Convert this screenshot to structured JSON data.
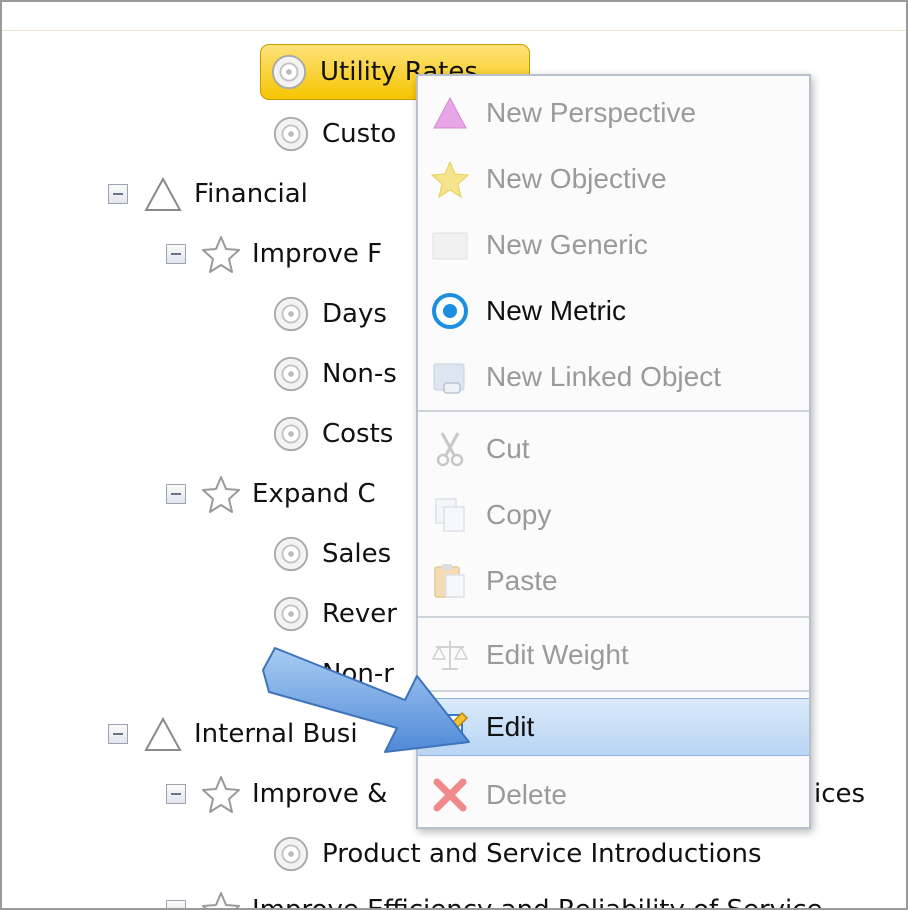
{
  "tree": {
    "rows": [
      {
        "label": "Utility Rates",
        "icon": "metric-icon",
        "selected": true
      },
      {
        "label": "Custo",
        "icon": "metric-icon"
      },
      {
        "label": "Financial",
        "icon": "perspective-icon",
        "expanded": true
      },
      {
        "label": "Improve F",
        "icon": "objective-star-icon",
        "expanded": true
      },
      {
        "label": "Days",
        "icon": "metric-icon"
      },
      {
        "label": "Non-s",
        "icon": "metric-icon"
      },
      {
        "label": "Costs",
        "icon": "metric-icon"
      },
      {
        "label": "Expand C",
        "icon": "objective-star-icon",
        "expanded": true
      },
      {
        "label": "Sales",
        "icon": "metric-icon"
      },
      {
        "label": "Rever",
        "icon": "metric-icon"
      },
      {
        "label": "Non-r",
        "icon": "metric-icon"
      },
      {
        "label": "Internal Busi",
        "icon": "perspective-icon",
        "expanded": true
      },
      {
        "label": "Improve &",
        "icon": "objective-star-icon",
        "expanded": true
      },
      {
        "label": "ices",
        "icon": "none"
      },
      {
        "label": "Product and Service Introductions",
        "icon": "metric-icon"
      },
      {
        "label": "Improve Efficiency and Reliability of Service",
        "icon": "objective-star-icon",
        "expanded": true
      }
    ]
  },
  "context_menu": {
    "items": [
      {
        "label": "New Perspective",
        "icon": "perspective-pink-icon",
        "enabled": false
      },
      {
        "label": "New Objective",
        "icon": "objective-yellow-icon",
        "enabled": false
      },
      {
        "label": "New Generic",
        "icon": "generic-icon",
        "enabled": false
      },
      {
        "label": "New Metric",
        "icon": "metric-blue-icon",
        "enabled": true
      },
      {
        "label": "New Linked Object",
        "icon": "linked-object-icon",
        "enabled": false
      },
      {
        "label": "Cut",
        "icon": "scissors-icon",
        "enabled": false
      },
      {
        "label": "Copy",
        "icon": "copy-icon",
        "enabled": false
      },
      {
        "label": "Paste",
        "icon": "paste-icon",
        "enabled": false
      },
      {
        "label": "Edit Weight",
        "icon": "scale-icon",
        "enabled": false
      },
      {
        "label": "Edit",
        "icon": "edit-pencil-icon",
        "enabled": true,
        "highlighted": true
      },
      {
        "label": "Delete",
        "icon": "delete-x-icon",
        "enabled": false
      }
    ]
  },
  "colors": {
    "selection": "#f5c500",
    "menu_highlight": "#b9d5f3",
    "arrow": "#6fa4e0"
  }
}
